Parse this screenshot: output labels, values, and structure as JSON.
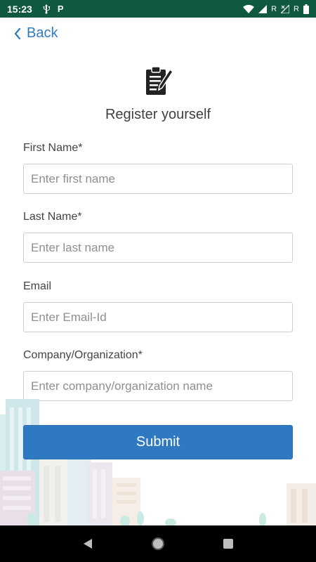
{
  "status_bar": {
    "time": "15:23",
    "usb_icon": "usb-icon",
    "p_badge": "P",
    "wifi_icon": "wifi-icon",
    "signal1_label": "R",
    "signal2_label": "R",
    "battery_icon": "battery-icon"
  },
  "nav": {
    "back_label": "Back"
  },
  "header": {
    "icon": "clipboard-edit-icon",
    "title": "Register yourself"
  },
  "form": {
    "first_name": {
      "label": "First Name*",
      "placeholder": "Enter first name",
      "value": ""
    },
    "last_name": {
      "label": "Last Name*",
      "placeholder": "Enter last name",
      "value": ""
    },
    "email": {
      "label": "Email",
      "placeholder": "Enter Email-Id",
      "value": ""
    },
    "company": {
      "label": "Company/Organization*",
      "placeholder": "Enter company/organization name",
      "value": ""
    },
    "submit_label": "Submit"
  },
  "colors": {
    "status_bar": "#0f5a3f",
    "accent": "#2f7bc3",
    "button": "#2f79c2"
  },
  "system_nav": {
    "back": "triangle-back-icon",
    "home": "circle-home-icon",
    "recents": "square-recents-icon"
  }
}
